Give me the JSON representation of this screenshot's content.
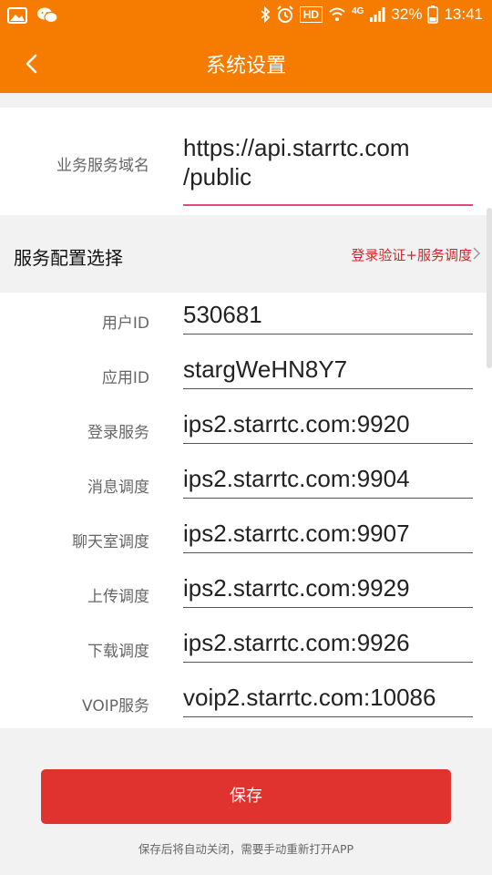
{
  "status": {
    "network": "4G",
    "hd": "HD",
    "battery": "32%",
    "time": "13:41"
  },
  "appbar": {
    "title": "系统设置"
  },
  "domain": {
    "label": "业务服务域名",
    "line1": "https://api.starrtc.com",
    "line2": "/public"
  },
  "section": {
    "title": "服务配置选择",
    "value": "登录验证+服务调度"
  },
  "fields": [
    {
      "label": "用户ID",
      "value": "530681"
    },
    {
      "label": "应用ID",
      "value": "stargWeHN8Y7"
    },
    {
      "label": "登录服务",
      "value": "ips2.starrtc.com:9920"
    },
    {
      "label": "消息调度",
      "value": "ips2.starrtc.com:9904"
    },
    {
      "label": "聊天室调度",
      "value": "ips2.starrtc.com:9907"
    },
    {
      "label": "上传调度",
      "value": "ips2.starrtc.com:9929"
    },
    {
      "label": "下载调度",
      "value": "ips2.starrtc.com:9926"
    },
    {
      "label": "VOIP服务",
      "value": "voip2.starrtc.com:10086"
    }
  ],
  "save_label": "保存",
  "hint": "保存后将自动关闭，需要手动重新打开APP",
  "colors": {
    "primary": "#f57c00",
    "save": "#e0322f",
    "accent_text": "#d8232a",
    "active_underline": "#e14a7f"
  }
}
